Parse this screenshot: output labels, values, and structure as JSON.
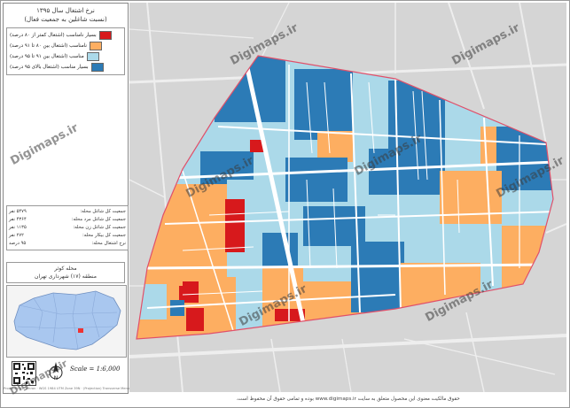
{
  "title": {
    "line1": "نرخ اشتغال سال ۱۳۹۵",
    "line2": "(نسبت شاغلین به جمعیت فعال)"
  },
  "legend": [
    {
      "label": "بسیار نامناسب (اشتغال کمتر از ۸۰ درصد)",
      "color": "#d7191c"
    },
    {
      "label": "نامناسب (اشتغال بین ۸۰ تا ۹۱ درصد)",
      "color": "#fdae61"
    },
    {
      "label": "مناسب (اشتغال بین ۹۱ تا ۹۵ درصد)",
      "color": "#abd9e9"
    },
    {
      "label": "بسیار مناسب (اشتغال بالای ۹۵ درصد)",
      "color": "#2c7bb6"
    }
  ],
  "stats": [
    {
      "label": "جمعیت کل شاغل محله:",
      "value": "۵۴۷۹ نفر"
    },
    {
      "label": "جمعیت کل شاغل مرد محله:",
      "value": "۴۳۶۴ نفر"
    },
    {
      "label": "جمعیت کل شاغل زن محله:",
      "value": "۱۱۳۵ نفر"
    },
    {
      "label": "جمعیت کل بیکار محله:",
      "value": "۲۷۲ نفر"
    },
    {
      "label": "نرخ اشتغال محله:",
      "value": "۹۵ درصد"
    }
  ],
  "area": {
    "name": "محله کوثر",
    "district": "منطقه (۱۷) شهرداری تهران"
  },
  "scale": "Scale = 1:6,000",
  "footer": "حقوق مالکیت معنوی این محصول متعلق به سایت www.digimaps.ir بوده و تمامی حقوق آن محفوظ است.",
  "watermark": "Digimaps.ir",
  "credit": "Produced by: Tehran · WGS 1984 UTM Zone 39N · (Projection) Transverse Mercator",
  "icons": {
    "north": "north-arrow-icon",
    "qr": "qr-code-icon"
  },
  "colors": {
    "very_poor": "#d7191c",
    "poor": "#fdae61",
    "good": "#abd9e9",
    "very_good": "#2c7bb6",
    "boundary": "#e0506a",
    "basemap": "#d5d5d5"
  }
}
